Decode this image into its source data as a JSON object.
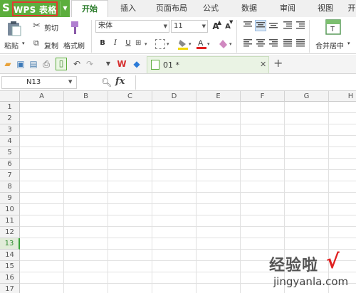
{
  "app": {
    "logo": "S",
    "name": "WPS 表格"
  },
  "tabs": [
    "开始",
    "插入",
    "页面布局",
    "公式",
    "数据",
    "审阅",
    "视图",
    "开"
  ],
  "active_tab": 0,
  "ribbon": {
    "paste_label": "粘贴",
    "cut_label": "剪切",
    "copy_label": "复制",
    "format_painter_label": "格式刷",
    "font_name": "宋体",
    "font_size": "11",
    "bold": "B",
    "italic": "I",
    "underline": "U",
    "increase_font": "A",
    "decrease_font": "A",
    "merge_center_label": "合并居中"
  },
  "document_tab": {
    "name": "01 *"
  },
  "formula_bar": {
    "cell_ref": "N13",
    "fx": "fx",
    "value": ""
  },
  "columns": [
    "A",
    "B",
    "C",
    "D",
    "E",
    "F",
    "G",
    "H"
  ],
  "rows": [
    "1",
    "2",
    "3",
    "4",
    "5",
    "6",
    "7",
    "8",
    "9",
    "10",
    "11",
    "12",
    "13",
    "14",
    "15",
    "16",
    "17"
  ],
  "active_row": "13",
  "watermark": {
    "text": "经验啦",
    "check": "√",
    "url": "jingyanla.com"
  },
  "colors": {
    "brand_green": "#5cae3d",
    "highlight_red": "#e33b2f",
    "active_row": "#3aa23a"
  }
}
